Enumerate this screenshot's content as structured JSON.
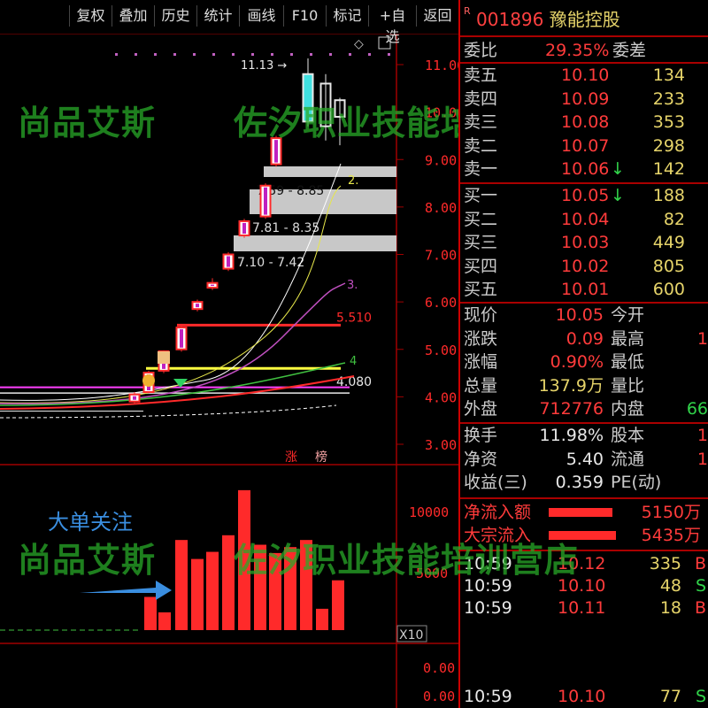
{
  "toolbar": {
    "buttons": [
      "复权",
      "叠加",
      "历史",
      "统计",
      "画线",
      "F10",
      "标记",
      "+自选",
      "返回"
    ]
  },
  "chart": {
    "price_axis": [
      "11.00",
      "10.00",
      "9.00",
      "8.00",
      "7.00",
      "6.00",
      "5.00",
      "4.00",
      "3.00"
    ],
    "volume_axis": [
      "10000",
      "5000"
    ],
    "sub_axis": [
      "0.00",
      "0.00"
    ],
    "zoom_label": "X10",
    "high_marker": "11.13",
    "zone_labels": [
      "7.59 - 8.85",
      "7.81 - 8.35",
      "7.10 - 7.42"
    ],
    "line_labels": [
      "5.510",
      "4.080",
      "2.",
      "3.",
      "4"
    ],
    "limit_up_tags": [
      "涨",
      "榜"
    ],
    "annotation": "大单关注",
    "candles": [
      {
        "o": 3.9,
        "c": 4.05,
        "h": 4.1,
        "l": 3.85
      },
      {
        "o": 4.1,
        "c": 4.51,
        "h": 4.55,
        "l": 4.08
      },
      {
        "o": 4.55,
        "c": 4.96,
        "h": 4.98,
        "l": 4.5
      },
      {
        "o": 5.0,
        "c": 5.46,
        "h": 5.5,
        "l": 4.95
      },
      {
        "o": 5.85,
        "c": 6.0,
        "h": 6.05,
        "l": 5.8
      },
      {
        "o": 6.3,
        "c": 6.4,
        "h": 6.5,
        "l": 6.25
      },
      {
        "o": 6.7,
        "c": 7.0,
        "h": 7.05,
        "l": 6.65
      },
      {
        "o": 7.4,
        "c": 7.7,
        "h": 7.75,
        "l": 7.35
      },
      {
        "o": 7.8,
        "c": 8.45,
        "h": 8.5,
        "l": 7.75
      },
      {
        "o": 8.9,
        "c": 9.45,
        "h": 9.5,
        "l": 8.85
      },
      {
        "o": 10.8,
        "c": 9.8,
        "h": 11.13,
        "l": 9.7
      },
      {
        "o": 10.6,
        "c": 9.7,
        "h": 10.8,
        "l": 9.4
      },
      {
        "o": 10.25,
        "c": 9.9,
        "h": 10.3,
        "l": 9.3
      }
    ],
    "volumes": [
      2800,
      1500,
      0,
      7600,
      6000,
      6600,
      8000,
      11800,
      7200,
      6500,
      7000,
      7600,
      0,
      1800,
      4200
    ]
  },
  "watermarks": [
    "尚品艾斯",
    "佐汐职业技能培训营店",
    "尚品艾斯",
    "佐汐职业技能培训营店"
  ],
  "panel": {
    "flag": "R",
    "code": "001896",
    "name": "豫能控股",
    "weibi_label": "委比",
    "weibi_value": "29.35%",
    "weicha_label": "委差",
    "sells": [
      {
        "label": "卖五",
        "price": "10.10",
        "vol": "134"
      },
      {
        "label": "卖四",
        "price": "10.09",
        "vol": "233"
      },
      {
        "label": "卖三",
        "price": "10.08",
        "vol": "353"
      },
      {
        "label": "卖二",
        "price": "10.07",
        "vol": "298"
      },
      {
        "label": "卖一",
        "price": "10.06",
        "vol": "142",
        "arrow": "↓"
      }
    ],
    "buys": [
      {
        "label": "买一",
        "price": "10.05",
        "vol": "188",
        "arrow": "↓"
      },
      {
        "label": "买二",
        "price": "10.04",
        "vol": "82"
      },
      {
        "label": "买三",
        "price": "10.03",
        "vol": "449"
      },
      {
        "label": "买四",
        "price": "10.02",
        "vol": "805"
      },
      {
        "label": "买五",
        "price": "10.01",
        "vol": "600"
      }
    ],
    "quote": [
      {
        "l1": "现价",
        "v1": "10.05",
        "l2": "今开",
        "v2": ""
      },
      {
        "l1": "涨跌",
        "v1": "0.09",
        "l2": "最高",
        "v2": "1"
      },
      {
        "l1": "涨幅",
        "v1": "0.90%",
        "l2": "最低",
        "v2": ""
      },
      {
        "l1": "总量",
        "v1": "137.9万",
        "l2": "量比",
        "v2": ""
      },
      {
        "l1": "外盘",
        "v1": "712776",
        "l2": "内盘",
        "v2": "66"
      }
    ],
    "stats": [
      {
        "l1": "换手",
        "v1": "11.98%",
        "l2": "股本",
        "v2": "1"
      },
      {
        "l1": "净资",
        "v1": "5.40",
        "l2": "流通",
        "v2": "1"
      },
      {
        "l1": "收益(三)",
        "v1": "0.359",
        "l2": "PE(动)",
        "v2": ""
      }
    ],
    "flows": [
      {
        "label": "净流入额",
        "value": "5150万"
      },
      {
        "label": "大宗流入",
        "value": "5435万"
      }
    ],
    "ticks": [
      {
        "time": "10:59",
        "price": "10.12",
        "vol": "335",
        "side": "B"
      },
      {
        "time": "10:59",
        "price": "10.10",
        "vol": "48",
        "side": "S"
      },
      {
        "time": "10:59",
        "price": "10.11",
        "vol": "18",
        "side": "B"
      },
      {
        "time": "10:59",
        "price": "10.10",
        "vol": "77",
        "side": "S"
      }
    ]
  },
  "colors": {
    "up": "#ff2a2a",
    "down": "#31d34a",
    "accent": "#e6d46a",
    "panel_border": "#c00000"
  }
}
